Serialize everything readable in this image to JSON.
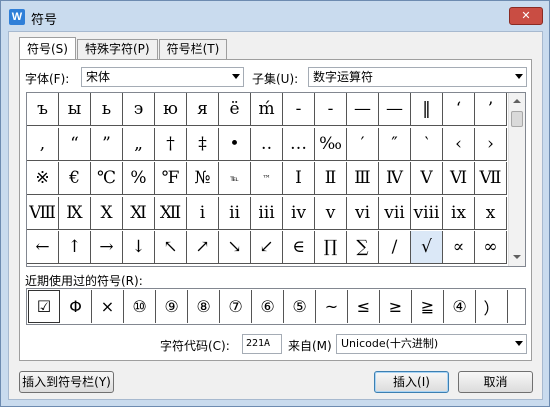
{
  "window": {
    "title": "符号",
    "app_icon": "W"
  },
  "tabs": [
    {
      "label": "符号(S)"
    },
    {
      "label": "特殊字符(P)"
    },
    {
      "label": "符号栏(T)"
    }
  ],
  "font": {
    "label": "字体(F):",
    "value": "宋体"
  },
  "subset": {
    "label": "子集(U):",
    "value": "数字运算符"
  },
  "symbols": [
    [
      "ъ",
      "ы",
      "ь",
      "э",
      "ю",
      "я",
      "ё",
      "ḿ",
      "-",
      "-",
      "—",
      "—",
      "‖",
      "‘",
      "’"
    ],
    [
      ",",
      "“",
      "”",
      "„",
      "†",
      "‡",
      "•",
      "‥",
      "…",
      "‰",
      "′",
      "″",
      "‵",
      "‹",
      "›"
    ],
    [
      "※",
      "€",
      "℃",
      "%",
      "℉",
      "№",
      "℡",
      "™",
      "Ⅰ",
      "Ⅱ",
      "Ⅲ",
      "Ⅳ",
      "Ⅴ",
      "Ⅵ",
      "Ⅶ"
    ],
    [
      "Ⅷ",
      "Ⅸ",
      "Ⅹ",
      "Ⅺ",
      "Ⅻ",
      "ⅰ",
      "ⅱ",
      "ⅲ",
      "ⅳ",
      "ⅴ",
      "ⅵ",
      "ⅶ",
      "ⅷ",
      "ⅸ",
      "ⅹ"
    ],
    [
      "←",
      "↑",
      "→",
      "↓",
      "↖",
      "↗",
      "↘",
      "↙",
      "∈",
      "∏",
      "∑",
      "∕",
      "√",
      "∝",
      "∞"
    ]
  ],
  "recent": {
    "label": "近期使用过的符号(R):",
    "items": [
      "☑",
      "Φ",
      "×",
      "⑩",
      "⑨",
      "⑧",
      "⑦",
      "⑥",
      "⑤",
      "~",
      "≤",
      "≥",
      "≧",
      "④",
      "）"
    ]
  },
  "char_code": {
    "label": "字符代码(C):",
    "value": "221A",
    "from_label": "来自(M)",
    "from_value": "Unicode(十六进制)"
  },
  "buttons": {
    "insert_to_bar": "插入到符号栏(Y)",
    "insert": "插入(I)",
    "cancel": "取消"
  }
}
